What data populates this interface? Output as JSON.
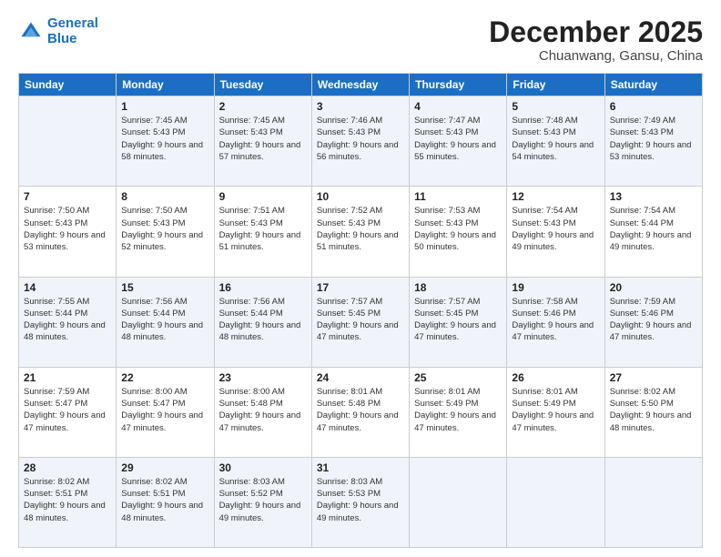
{
  "header": {
    "logo_line1": "General",
    "logo_line2": "Blue",
    "month": "December 2025",
    "location": "Chuanwang, Gansu, China"
  },
  "days_of_week": [
    "Sunday",
    "Monday",
    "Tuesday",
    "Wednesday",
    "Thursday",
    "Friday",
    "Saturday"
  ],
  "weeks": [
    [
      {
        "day": "",
        "info": ""
      },
      {
        "day": "1",
        "info": "Sunrise: 7:45 AM\nSunset: 5:43 PM\nDaylight: 9 hours\nand 58 minutes."
      },
      {
        "day": "2",
        "info": "Sunrise: 7:45 AM\nSunset: 5:43 PM\nDaylight: 9 hours\nand 57 minutes."
      },
      {
        "day": "3",
        "info": "Sunrise: 7:46 AM\nSunset: 5:43 PM\nDaylight: 9 hours\nand 56 minutes."
      },
      {
        "day": "4",
        "info": "Sunrise: 7:47 AM\nSunset: 5:43 PM\nDaylight: 9 hours\nand 55 minutes."
      },
      {
        "day": "5",
        "info": "Sunrise: 7:48 AM\nSunset: 5:43 PM\nDaylight: 9 hours\nand 54 minutes."
      },
      {
        "day": "6",
        "info": "Sunrise: 7:49 AM\nSunset: 5:43 PM\nDaylight: 9 hours\nand 53 minutes."
      }
    ],
    [
      {
        "day": "7",
        "info": "Sunrise: 7:50 AM\nSunset: 5:43 PM\nDaylight: 9 hours\nand 53 minutes."
      },
      {
        "day": "8",
        "info": "Sunrise: 7:50 AM\nSunset: 5:43 PM\nDaylight: 9 hours\nand 52 minutes."
      },
      {
        "day": "9",
        "info": "Sunrise: 7:51 AM\nSunset: 5:43 PM\nDaylight: 9 hours\nand 51 minutes."
      },
      {
        "day": "10",
        "info": "Sunrise: 7:52 AM\nSunset: 5:43 PM\nDaylight: 9 hours\nand 51 minutes."
      },
      {
        "day": "11",
        "info": "Sunrise: 7:53 AM\nSunset: 5:43 PM\nDaylight: 9 hours\nand 50 minutes."
      },
      {
        "day": "12",
        "info": "Sunrise: 7:54 AM\nSunset: 5:43 PM\nDaylight: 9 hours\nand 49 minutes."
      },
      {
        "day": "13",
        "info": "Sunrise: 7:54 AM\nSunset: 5:44 PM\nDaylight: 9 hours\nand 49 minutes."
      }
    ],
    [
      {
        "day": "14",
        "info": "Sunrise: 7:55 AM\nSunset: 5:44 PM\nDaylight: 9 hours\nand 48 minutes."
      },
      {
        "day": "15",
        "info": "Sunrise: 7:56 AM\nSunset: 5:44 PM\nDaylight: 9 hours\nand 48 minutes."
      },
      {
        "day": "16",
        "info": "Sunrise: 7:56 AM\nSunset: 5:44 PM\nDaylight: 9 hours\nand 48 minutes."
      },
      {
        "day": "17",
        "info": "Sunrise: 7:57 AM\nSunset: 5:45 PM\nDaylight: 9 hours\nand 47 minutes."
      },
      {
        "day": "18",
        "info": "Sunrise: 7:57 AM\nSunset: 5:45 PM\nDaylight: 9 hours\nand 47 minutes."
      },
      {
        "day": "19",
        "info": "Sunrise: 7:58 AM\nSunset: 5:46 PM\nDaylight: 9 hours\nand 47 minutes."
      },
      {
        "day": "20",
        "info": "Sunrise: 7:59 AM\nSunset: 5:46 PM\nDaylight: 9 hours\nand 47 minutes."
      }
    ],
    [
      {
        "day": "21",
        "info": "Sunrise: 7:59 AM\nSunset: 5:47 PM\nDaylight: 9 hours\nand 47 minutes."
      },
      {
        "day": "22",
        "info": "Sunrise: 8:00 AM\nSunset: 5:47 PM\nDaylight: 9 hours\nand 47 minutes."
      },
      {
        "day": "23",
        "info": "Sunrise: 8:00 AM\nSunset: 5:48 PM\nDaylight: 9 hours\nand 47 minutes."
      },
      {
        "day": "24",
        "info": "Sunrise: 8:01 AM\nSunset: 5:48 PM\nDaylight: 9 hours\nand 47 minutes."
      },
      {
        "day": "25",
        "info": "Sunrise: 8:01 AM\nSunset: 5:49 PM\nDaylight: 9 hours\nand 47 minutes."
      },
      {
        "day": "26",
        "info": "Sunrise: 8:01 AM\nSunset: 5:49 PM\nDaylight: 9 hours\nand 47 minutes."
      },
      {
        "day": "27",
        "info": "Sunrise: 8:02 AM\nSunset: 5:50 PM\nDaylight: 9 hours\nand 48 minutes."
      }
    ],
    [
      {
        "day": "28",
        "info": "Sunrise: 8:02 AM\nSunset: 5:51 PM\nDaylight: 9 hours\nand 48 minutes."
      },
      {
        "day": "29",
        "info": "Sunrise: 8:02 AM\nSunset: 5:51 PM\nDaylight: 9 hours\nand 48 minutes."
      },
      {
        "day": "30",
        "info": "Sunrise: 8:03 AM\nSunset: 5:52 PM\nDaylight: 9 hours\nand 49 minutes."
      },
      {
        "day": "31",
        "info": "Sunrise: 8:03 AM\nSunset: 5:53 PM\nDaylight: 9 hours\nand 49 minutes."
      },
      {
        "day": "",
        "info": ""
      },
      {
        "day": "",
        "info": ""
      },
      {
        "day": "",
        "info": ""
      }
    ]
  ]
}
